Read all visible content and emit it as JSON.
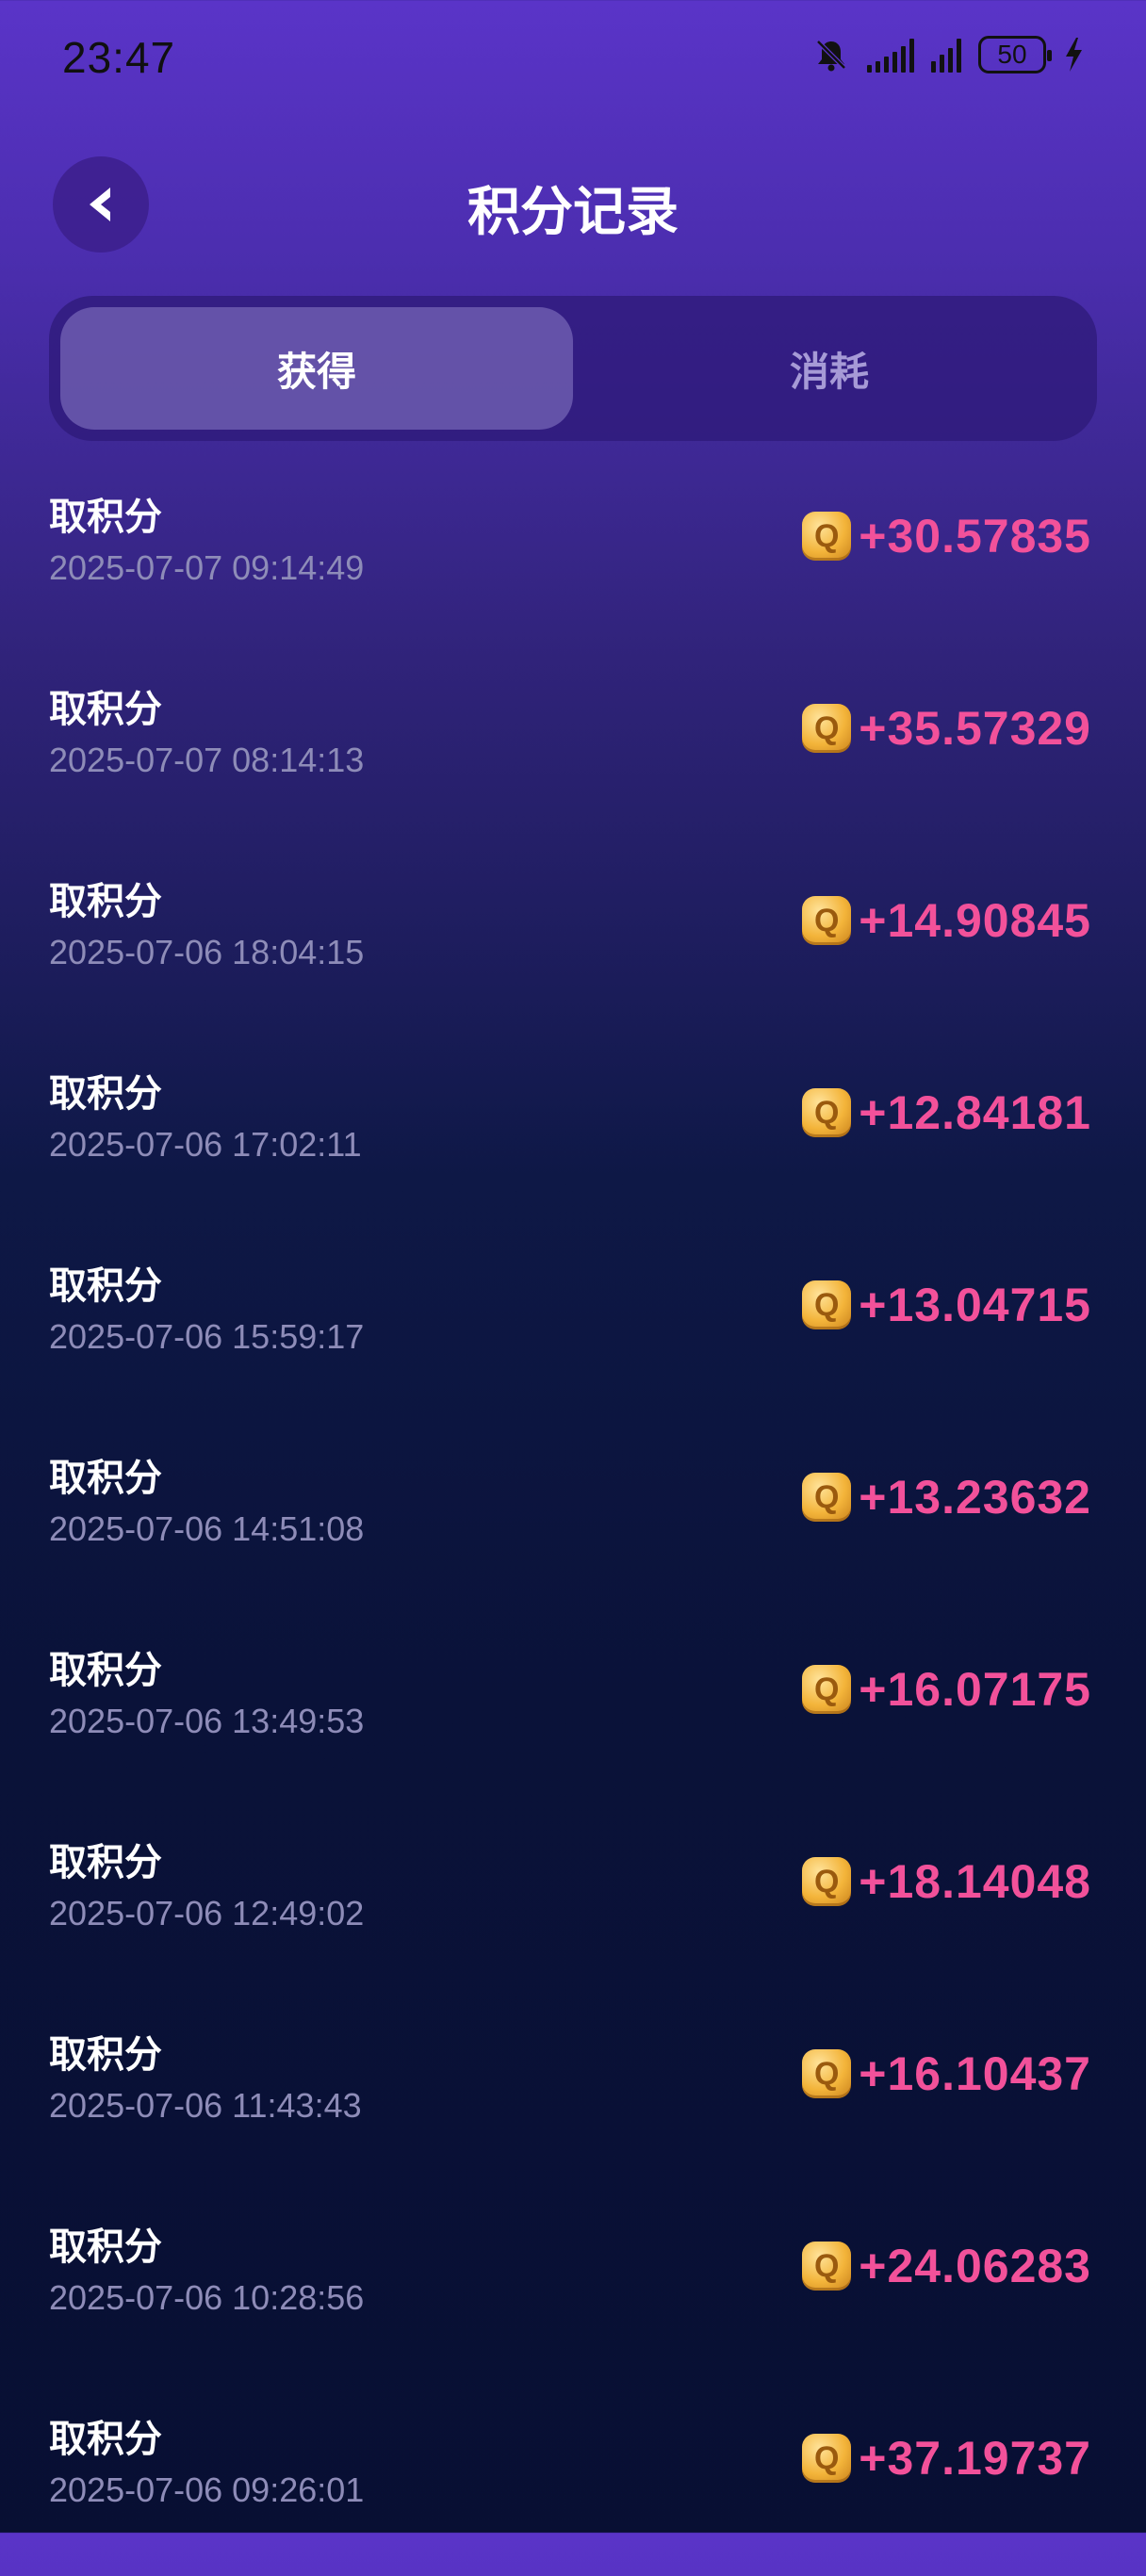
{
  "status_bar": {
    "time": "23:47",
    "battery": "50",
    "icons": [
      "bell-muted-icon",
      "signal-icon",
      "signal-icon",
      "battery-icon",
      "charging-icon"
    ]
  },
  "header": {
    "title": "积分记录",
    "back_icon": "chevron-left-icon"
  },
  "tabs": [
    {
      "label": "获得",
      "active": true
    },
    {
      "label": "消耗",
      "active": false
    }
  ],
  "records": [
    {
      "title": "取积分",
      "time": "2025-07-07 09:14:49",
      "amount": "+30.57835"
    },
    {
      "title": "取积分",
      "time": "2025-07-07 08:14:13",
      "amount": "+35.57329"
    },
    {
      "title": "取积分",
      "time": "2025-07-06 18:04:15",
      "amount": "+14.90845"
    },
    {
      "title": "取积分",
      "time": "2025-07-06 17:02:11",
      "amount": "+12.84181"
    },
    {
      "title": "取积分",
      "time": "2025-07-06 15:59:17",
      "amount": "+13.04715"
    },
    {
      "title": "取积分",
      "time": "2025-07-06 14:51:08",
      "amount": "+13.23632"
    },
    {
      "title": "取积分",
      "time": "2025-07-06 13:49:53",
      "amount": "+16.07175"
    },
    {
      "title": "取积分",
      "time": "2025-07-06 12:49:02",
      "amount": "+18.14048"
    },
    {
      "title": "取积分",
      "time": "2025-07-06 11:43:43",
      "amount": "+16.10437"
    },
    {
      "title": "取积分",
      "time": "2025-07-06 10:28:56",
      "amount": "+24.06283"
    },
    {
      "title": "取积分",
      "time": "2025-07-06 09:26:01",
      "amount": "+37.19737"
    }
  ],
  "colors": {
    "amount": "#f2519a",
    "accent_gradient_top": "#5a34c8",
    "background_bottom": "#080f33"
  }
}
